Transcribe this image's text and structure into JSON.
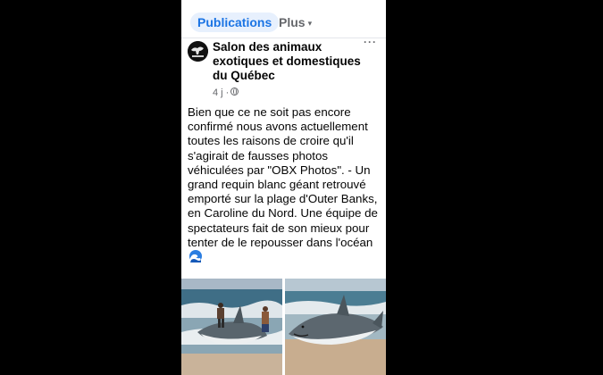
{
  "tabs": {
    "active_label": "Publications",
    "more_label": "Plus",
    "more_caret": "▾"
  },
  "post": {
    "page_name": "Salon des animaux exotiques et domestiques du Québec",
    "time": "4 j ·",
    "more_glyph": "···",
    "text": "Bien que ce ne soit pas encore confirmé nous avons actuellement toutes les raisons de croire qu'il s'agirait de fausses photos véhiculées par \"OBX Photos\". - Un grand requin blanc géant retrouvé emporté sur la plage d'Outer Banks, en Caroline du Nord. Une équipe de spectateurs fait de son mieux pour tenter de le repousser dans l'océan",
    "trailing_icon": "wave-icon"
  },
  "colors": {
    "accent": "#1b74e4",
    "accent_bg": "#e7f0fd",
    "secondary_text": "#65676b",
    "background": "#000000"
  },
  "photos": [
    {
      "name": "shark-photo-left",
      "icon": "shark-beach-photo"
    },
    {
      "name": "shark-photo-right",
      "icon": "shark-beach-photo"
    }
  ]
}
